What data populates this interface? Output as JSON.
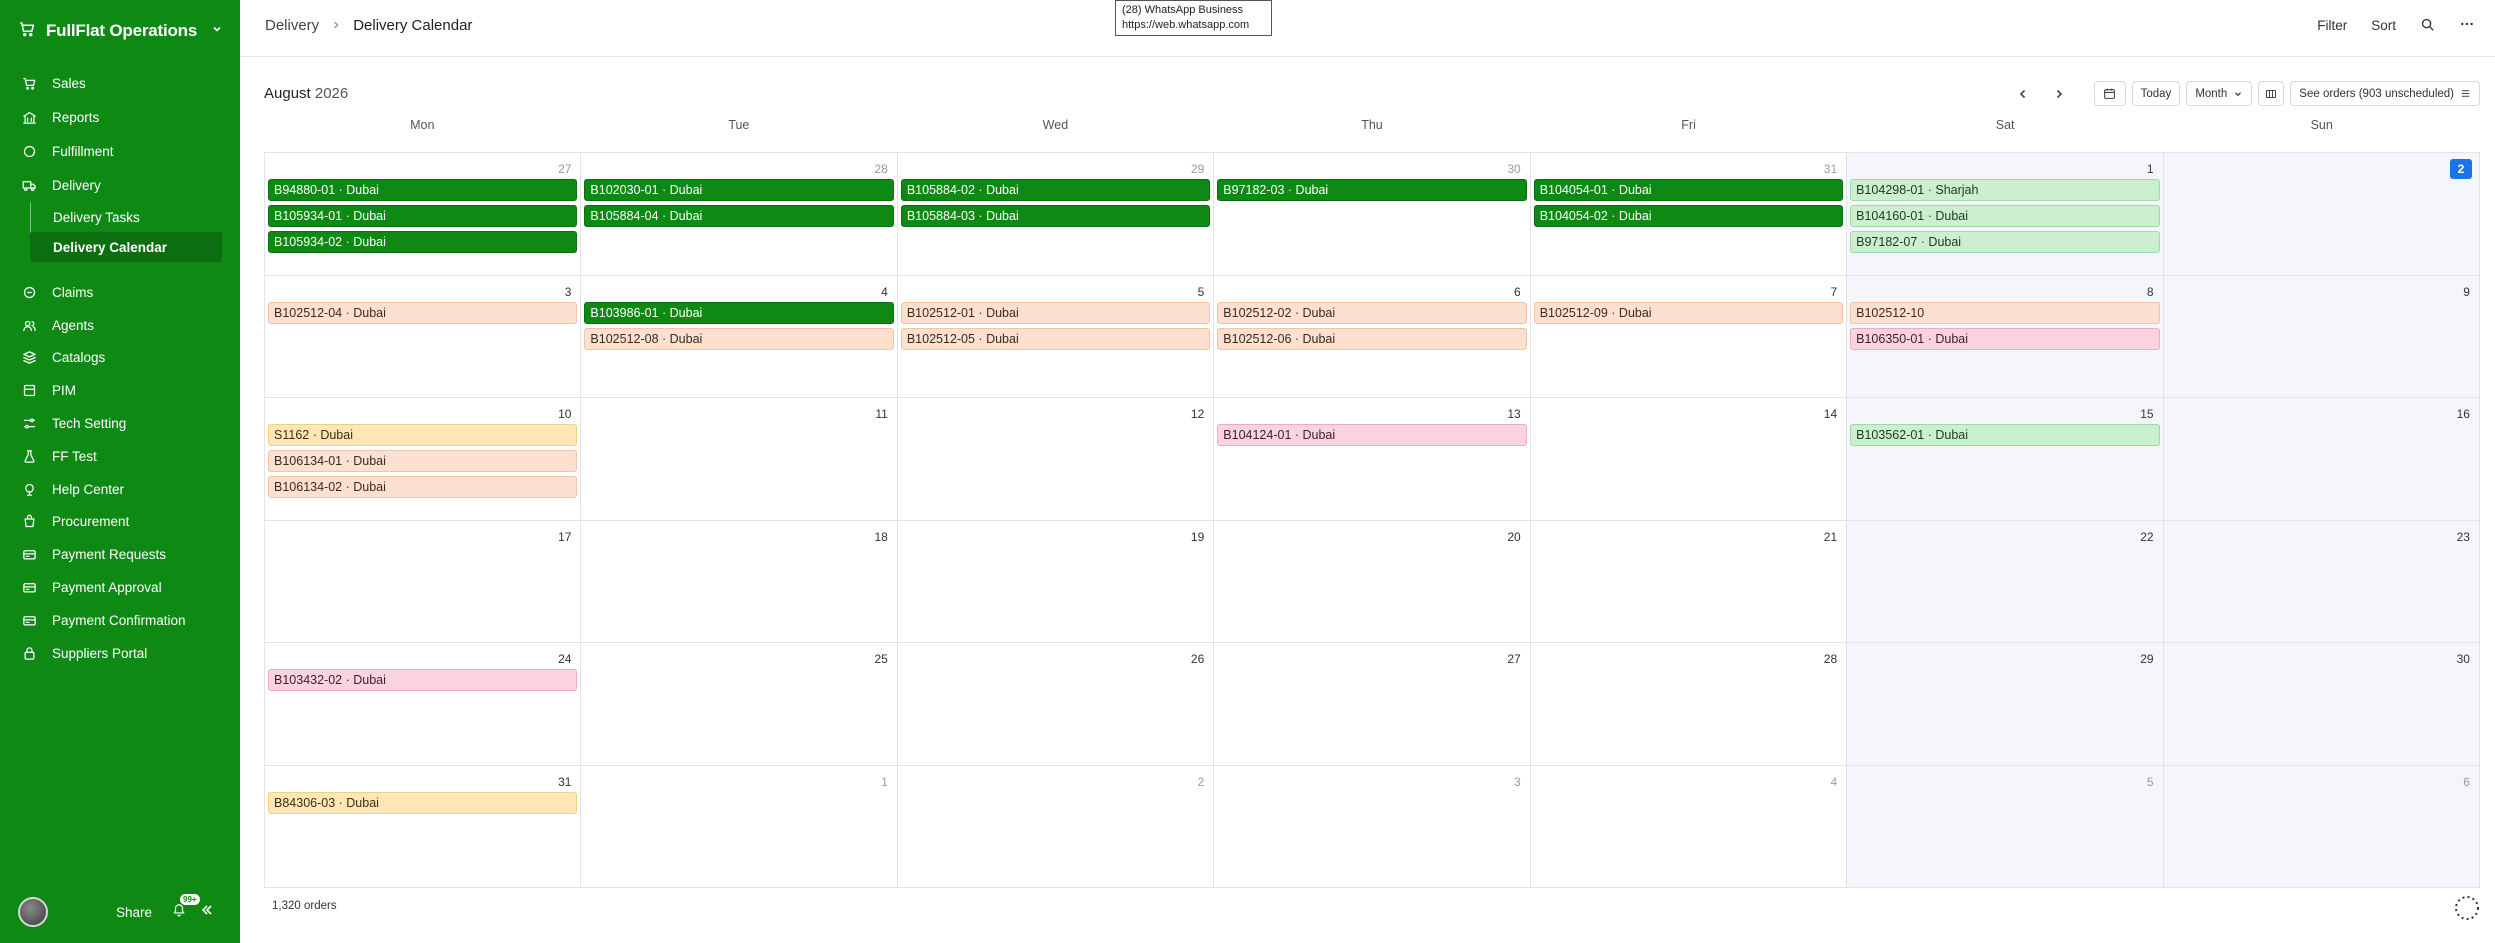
{
  "app": {
    "name": "FullFlat Operations"
  },
  "sidebar": {
    "items": [
      {
        "label": "Sales",
        "icon": "cart-icon"
      },
      {
        "label": "Reports",
        "icon": "bank-icon"
      },
      {
        "label": "Fulfillment",
        "icon": "circle-icon"
      },
      {
        "label": "Delivery",
        "icon": "truck-icon"
      }
    ],
    "sub_items": [
      {
        "label": "Delivery Tasks"
      },
      {
        "label": "Delivery Calendar"
      }
    ],
    "items_after": [
      {
        "label": "Claims",
        "icon": "claims-icon"
      },
      {
        "label": "Agents",
        "icon": "agents-icon"
      },
      {
        "label": "Catalogs",
        "icon": "catalogs-icon"
      },
      {
        "label": "PIM",
        "icon": "pim-icon"
      },
      {
        "label": "Tech Setting",
        "icon": "settings-icon"
      },
      {
        "label": "FF Test",
        "icon": "flask-icon"
      },
      {
        "label": "Help Center",
        "icon": "help-icon"
      },
      {
        "label": "Procurement",
        "icon": "procurement-icon"
      },
      {
        "label": "Payment Requests",
        "icon": "payment-icon"
      },
      {
        "label": "Payment Approval",
        "icon": "payment-icon"
      },
      {
        "label": "Payment Confirmation",
        "icon": "payment-icon"
      },
      {
        "label": "Suppliers Portal",
        "icon": "portal-icon"
      }
    ],
    "footer": {
      "share_label": "Share",
      "badge": "99+"
    }
  },
  "breadcrumb": {
    "parent": "Delivery",
    "current": "Delivery Calendar"
  },
  "tooltip": {
    "line1": "(28) WhatsApp Business",
    "line2": "https://web.whatsapp.com"
  },
  "top_actions": {
    "filter": "Filter",
    "sort": "Sort"
  },
  "calendar": {
    "title_month": "August",
    "title_year": "2026",
    "today_label": "Today",
    "view_label": "Month",
    "orders_label": "See orders (903 unscheduled)",
    "weekdays": [
      "Mon",
      "Tue",
      "Wed",
      "Thu",
      "Fri",
      "Sat",
      "Sun"
    ],
    "days": [
      {
        "n": "27",
        "other": true,
        "events": [
          {
            "label": "B94880-01 · Dubai",
            "color": "green"
          },
          {
            "label": "B105934-01 · Dubai",
            "color": "green"
          },
          {
            "label": "B105934-02 · Dubai",
            "color": "green"
          }
        ]
      },
      {
        "n": "28",
        "other": true,
        "events": [
          {
            "label": "B102030-01 · Dubai",
            "color": "green"
          },
          {
            "label": "B105884-04 · Dubai",
            "color": "green"
          }
        ]
      },
      {
        "n": "29",
        "other": true,
        "events": [
          {
            "label": "B105884-02 · Dubai",
            "color": "green"
          },
          {
            "label": "B105884-03 · Dubai",
            "color": "green"
          }
        ]
      },
      {
        "n": "30",
        "other": true,
        "events": [
          {
            "label": "B97182-03 · Dubai",
            "color": "green"
          }
        ]
      },
      {
        "n": "31",
        "other": true,
        "events": [
          {
            "label": "B104054-01 · Dubai",
            "color": "green"
          },
          {
            "label": "B104054-02 · Dubai",
            "color": "green"
          }
        ]
      },
      {
        "n": "1",
        "weekend": true,
        "events": [
          {
            "label": "B104298-01 · Sharjah",
            "color": "lightgreen"
          },
          {
            "label": "B104160-01 · Dubai",
            "color": "lightgreen"
          },
          {
            "label": "B97182-07 · Dubai",
            "color": "lightgreen"
          }
        ]
      },
      {
        "n": "2",
        "weekend": true,
        "today": true,
        "events": []
      },
      {
        "n": "3",
        "events": [
          {
            "label": "B102512-04 · Dubai",
            "color": "peach"
          }
        ]
      },
      {
        "n": "4",
        "events": [
          {
            "label": "B103986-01 · Dubai",
            "color": "green"
          },
          {
            "label": "B102512-08 · Dubai",
            "color": "peach"
          }
        ]
      },
      {
        "n": "5",
        "events": [
          {
            "label": "B102512-01 · Dubai",
            "color": "peach"
          },
          {
            "label": "B102512-05 · Dubai",
            "color": "peach"
          }
        ]
      },
      {
        "n": "6",
        "events": [
          {
            "label": "B102512-02 · Dubai",
            "color": "peach"
          },
          {
            "label": "B102512-06 · Dubai",
            "color": "peach"
          }
        ]
      },
      {
        "n": "7",
        "events": [
          {
            "label": "B102512-09 · Dubai",
            "color": "peach"
          }
        ]
      },
      {
        "n": "8",
        "weekend": true,
        "events": [
          {
            "label": "B102512-10",
            "color": "peach"
          },
          {
            "label": "B106350-01 · Dubai",
            "color": "pink"
          }
        ]
      },
      {
        "n": "9",
        "weekend": true,
        "events": []
      },
      {
        "n": "10",
        "events": [
          {
            "label": "S1162 · Dubai",
            "color": "yellow"
          },
          {
            "label": "B106134-01 · Dubai",
            "color": "peach"
          },
          {
            "label": "B106134-02 · Dubai",
            "color": "peach"
          }
        ]
      },
      {
        "n": "11",
        "events": []
      },
      {
        "n": "12",
        "events": []
      },
      {
        "n": "13",
        "events": [
          {
            "label": "B104124-01 · Dubai",
            "color": "pink"
          }
        ]
      },
      {
        "n": "14",
        "events": []
      },
      {
        "n": "15",
        "weekend": true,
        "events": [
          {
            "label": "B103562-01 · Dubai",
            "color": "lightgreen"
          }
        ]
      },
      {
        "n": "16",
        "weekend": true,
        "events": []
      },
      {
        "n": "17",
        "events": []
      },
      {
        "n": "18",
        "events": []
      },
      {
        "n": "19",
        "events": []
      },
      {
        "n": "20",
        "events": []
      },
      {
        "n": "21",
        "events": []
      },
      {
        "n": "22",
        "weekend": true,
        "events": []
      },
      {
        "n": "23",
        "weekend": true,
        "events": []
      },
      {
        "n": "24",
        "events": [
          {
            "label": "B103432-02 · Dubai",
            "color": "pink"
          }
        ]
      },
      {
        "n": "25",
        "events": []
      },
      {
        "n": "26",
        "events": []
      },
      {
        "n": "27",
        "events": []
      },
      {
        "n": "28",
        "events": []
      },
      {
        "n": "29",
        "weekend": true,
        "events": []
      },
      {
        "n": "30",
        "weekend": true,
        "events": []
      },
      {
        "n": "31",
        "events": [
          {
            "label": "B84306-03 · Dubai",
            "color": "yellow"
          }
        ]
      },
      {
        "n": "1",
        "other": true,
        "events": []
      },
      {
        "n": "2",
        "other": true,
        "events": []
      },
      {
        "n": "3",
        "other": true,
        "events": []
      },
      {
        "n": "4",
        "other": true,
        "events": []
      },
      {
        "n": "5",
        "other": true,
        "weekend": true,
        "events": []
      },
      {
        "n": "6",
        "other": true,
        "weekend": true,
        "events": []
      }
    ]
  },
  "footer": {
    "count": "1,320 orders"
  },
  "colors": {
    "sidebar": "#0e8a14",
    "today": "#1a73e8"
  }
}
